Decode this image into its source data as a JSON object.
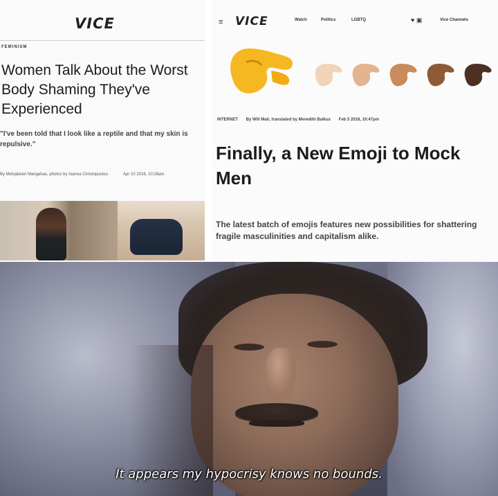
{
  "left_article": {
    "brand": "VICE",
    "section": "FEMINISM",
    "headline": "Women Talk About the Worst Body Shaming They've Experienced",
    "dek": "\"I've been told that I look like a reptile and that my skin is repulsive.\"",
    "byline": "By Mehjabeen Mangahas, photos by Ioanna Christopoulou",
    "date": "Apr 10 2016, 10:26am"
  },
  "right_article": {
    "brand": "VICE",
    "nav_links": [
      "Watch",
      "Politics",
      "LGBTQ"
    ],
    "nav_channels": "Vice Channels",
    "section": "INTERNET",
    "byline": "By Will Mair, translated by Meredith Balkus",
    "date": "Feb 5 2018, 10:47pm",
    "headline": "Finally, a New Emoji to Mock Men",
    "dek": "The latest batch of emojis features new possibilities for shattering fragile masculinities and capitalism alike.",
    "emoji_tones": [
      "#f2d3b9",
      "#e2b48f",
      "#c98b5b",
      "#8e5a34",
      "#4c3022"
    ],
    "emoji_main_color": "#f6b820"
  },
  "meme": {
    "caption": "It appears my hypocrisy knows no bounds."
  }
}
